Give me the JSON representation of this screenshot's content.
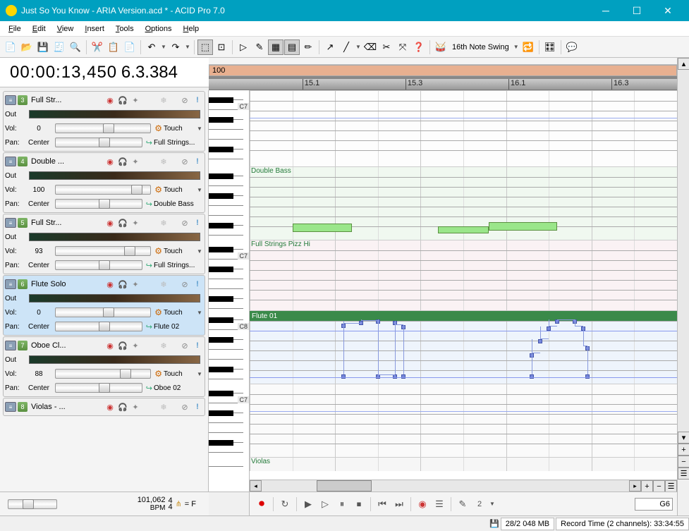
{
  "window": {
    "title": "Just So You Know - ARIA Version.acd * - ACID Pro 7.0"
  },
  "menu": {
    "file": "File",
    "edit": "Edit",
    "view": "View",
    "insert": "Insert",
    "tools": "Tools",
    "options": "Options",
    "help": "Help"
  },
  "toolbar": {
    "swing": "16th Note Swing"
  },
  "time": {
    "tc": "00:00:13,450",
    "pos": "6.3.384"
  },
  "bpm": {
    "value": "101,062",
    "label": "BPM",
    "ts_num": "4",
    "ts_den": "4",
    "key": "= F"
  },
  "tempo_marker": "100",
  "ruler": {
    "m1": "15.1",
    "m2": "15.3",
    "m3": "16.1",
    "m4": "16.3"
  },
  "piano": {
    "oct1": "C7",
    "oct2": "C7",
    "oct3": "C8",
    "oct4": "C7"
  },
  "tracks": [
    {
      "num": "3",
      "name": "Full Str...",
      "out": "Out",
      "vol": "0",
      "pan": "Center",
      "auto": "Touch",
      "bus": "Full Strings...",
      "volpos": 50,
      "panpos": 50
    },
    {
      "num": "4",
      "name": "Double ...",
      "out": "Out",
      "vol": "100",
      "pan": "Center",
      "auto": "Touch",
      "bus": "Double Bass",
      "volpos": 80,
      "panpos": 50
    },
    {
      "num": "5",
      "name": "Full Str...",
      "out": "Out",
      "vol": "93",
      "pan": "Center",
      "auto": "Touch",
      "bus": "Full Strings...",
      "volpos": 72,
      "panpos": 50
    },
    {
      "num": "6",
      "name": "Flute Solo",
      "out": "Out",
      "vol": "0",
      "pan": "Center",
      "auto": "Touch",
      "bus": "Flute 02",
      "volpos": 50,
      "panpos": 50,
      "selected": true
    },
    {
      "num": "7",
      "name": "Oboe Cl...",
      "out": "Out",
      "vol": "88",
      "pan": "Center",
      "auto": "Touch",
      "bus": "Oboe 02",
      "volpos": 68,
      "panpos": 50
    },
    {
      "num": "8",
      "name": "Violas - ...",
      "out": "",
      "vol": "",
      "pan": "",
      "auto": "",
      "bus": "",
      "volpos": 50,
      "panpos": 50,
      "collapsed": true
    }
  ],
  "lanes": {
    "l0": {
      "label": ""
    },
    "l1": {
      "label": "Double Bass"
    },
    "l2": {
      "label": "Full Strings Pizz Hi"
    },
    "l3": {
      "label": "Flute 01"
    },
    "l4": {},
    "l5": {
      "label": "Violas"
    }
  },
  "labels": {
    "vol": "Vol:",
    "pan": "Pan:"
  },
  "note_input": "G6",
  "status": {
    "mem": "28/2 048 MB",
    "rec": "Record Time (2 channels): 33:34:55"
  },
  "snap": "2"
}
